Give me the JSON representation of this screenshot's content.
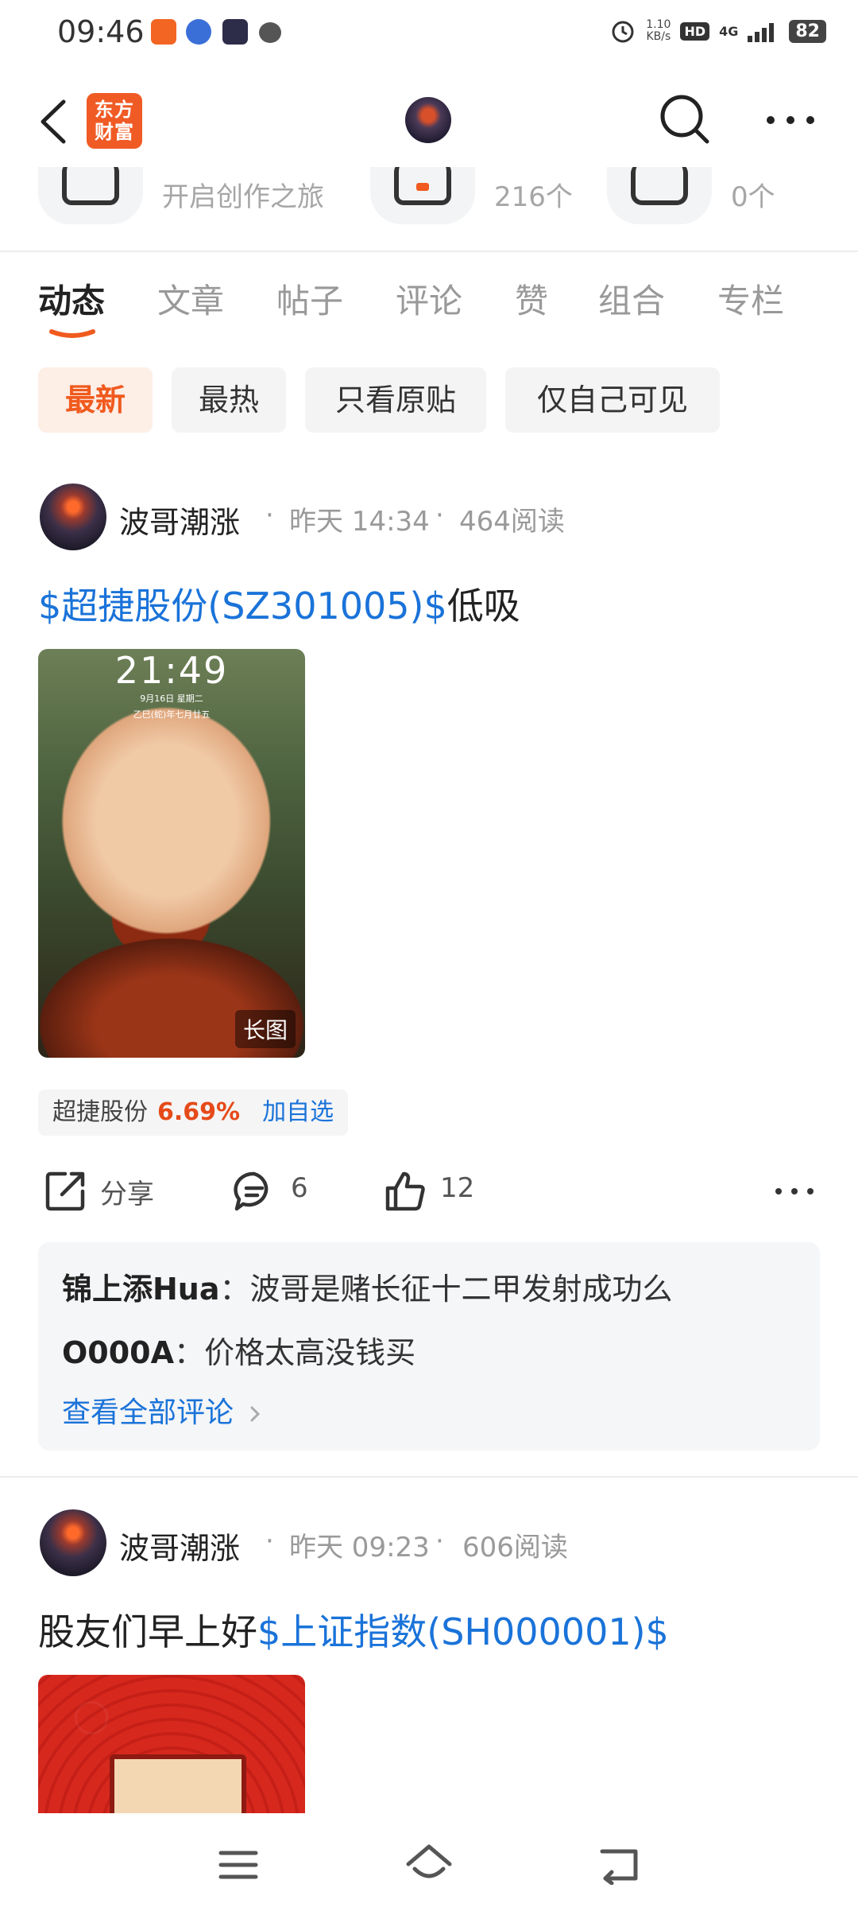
{
  "status_bar": {
    "time": "09:46",
    "speed_value": "1.10",
    "speed_unit": "KB/s",
    "hd": "HD",
    "network": "4G",
    "battery": "82"
  },
  "header": {
    "app_logo_line1": "东方",
    "app_logo_line2": "财富"
  },
  "stats": {
    "item1_text": "开启创作之旅",
    "item2_text": "216个",
    "item3_text": "0个"
  },
  "tabs": [
    "动态",
    "文章",
    "帖子",
    "评论",
    "赞",
    "组合",
    "专栏"
  ],
  "filters": [
    "最新",
    "最热",
    "只看原贴",
    "仅自己可见"
  ],
  "posts": [
    {
      "author": "波哥潮涨",
      "time": "昨天 14:34",
      "reads": "464阅读",
      "stock_link": "$超捷股份(SZ301005)$",
      "text_suffix": "低吸",
      "image": {
        "clock": "21:49",
        "date": "9月16日  星期二",
        "lunar": "乙巳(蛇)年七月廿五",
        "badge": "长图"
      },
      "stock_tag": {
        "name": "超捷股份",
        "change": "6.69%",
        "add": "加自选"
      },
      "actions": {
        "share": "分享",
        "comments": "6",
        "likes": "12"
      },
      "comments": [
        {
          "user": "锦上添Hua",
          "sep": "：",
          "text": "波哥是赌长征十二甲发射成功么"
        },
        {
          "user": "O000A",
          "sep": "：",
          "text": "价格太高没钱买"
        }
      ],
      "view_all": "查看全部评论"
    },
    {
      "author": "波哥潮涨",
      "time": "昨天 09:23",
      "reads": "606阅读",
      "text_prefix": "股友们早上好",
      "stock_link": "$上证指数(SH000001)$"
    }
  ],
  "colors": {
    "accent": "#f05a1e",
    "link": "#1a73d9",
    "gain": "#e64a19"
  }
}
